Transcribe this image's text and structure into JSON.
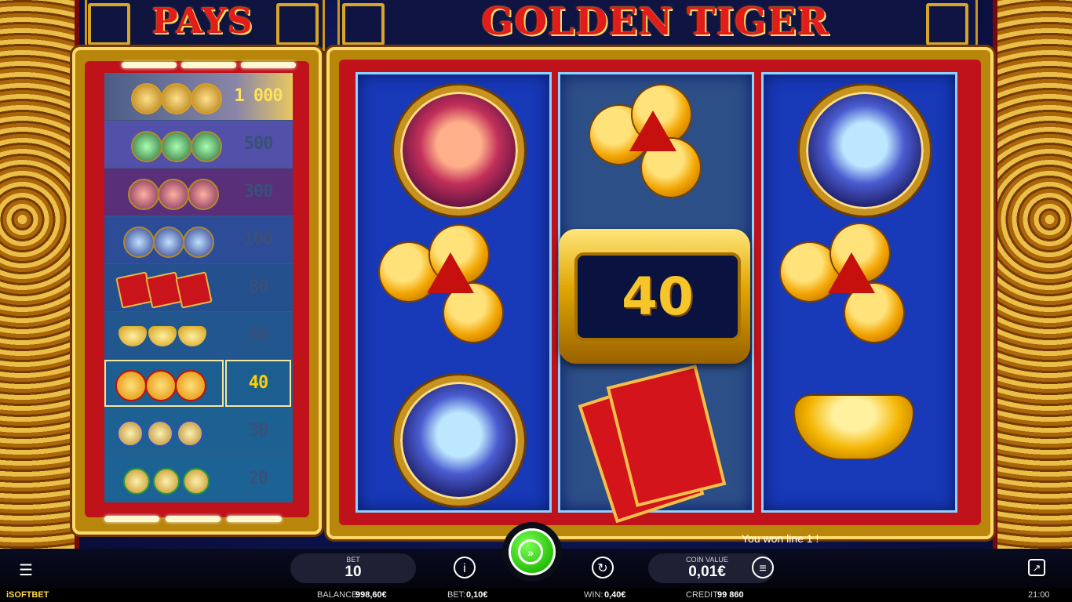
{
  "game": {
    "title": "GOLDEN TIGER",
    "pays_title": "PAYS"
  },
  "paytable": [
    {
      "symbol": "golden-tiger",
      "value": "1 000",
      "highlight": false
    },
    {
      "symbol": "green-tiger",
      "value": "500",
      "highlight": false
    },
    {
      "symbol": "red-tiger",
      "value": "300",
      "highlight": false
    },
    {
      "symbol": "blue-tiger",
      "value": "100",
      "highlight": false
    },
    {
      "symbol": "red-envelope",
      "value": "80",
      "highlight": false
    },
    {
      "symbol": "gold-ingot",
      "value": "60",
      "highlight": false
    },
    {
      "symbol": "lucky-coins",
      "value": "40",
      "highlight": true
    },
    {
      "symbol": "blue-knot-coins",
      "value": "30",
      "highlight": false
    },
    {
      "symbol": "green-knot-coins",
      "value": "20",
      "highlight": false
    }
  ],
  "reels": [
    [
      "red-tiger",
      "lucky-coins",
      "blue-tiger"
    ],
    [
      "lucky-coins",
      "win-amount",
      "red-envelope"
    ],
    [
      "blue-tiger",
      "lucky-coins",
      "gold-ingot"
    ]
  ],
  "win_badge": "40",
  "message": "You won line 1 !",
  "controls": {
    "bet_label": "BET",
    "bet_value": "10",
    "coin_label": "COIN VALUE",
    "coin_value": "0,01€"
  },
  "status": {
    "brand": "iSOFTBET",
    "balance_label": "BALANCE:",
    "balance_value": "998,60€",
    "bet_label": "BET:",
    "bet_value": "0,10€",
    "win_label": "WIN:",
    "win_value": "0,40€",
    "credit_label": "CREDIT:",
    "credit_value": "99 860",
    "time": "21:00"
  },
  "colors": {
    "title_red": "#e31b1b",
    "gold": "#c9961b",
    "reel_blue": "#1839b8",
    "spin_green": "#2cc60e"
  },
  "icons": [
    "menu-icon",
    "info-icon",
    "spin-icon",
    "autoplay-icon",
    "coin-stack-icon",
    "popout-icon"
  ]
}
